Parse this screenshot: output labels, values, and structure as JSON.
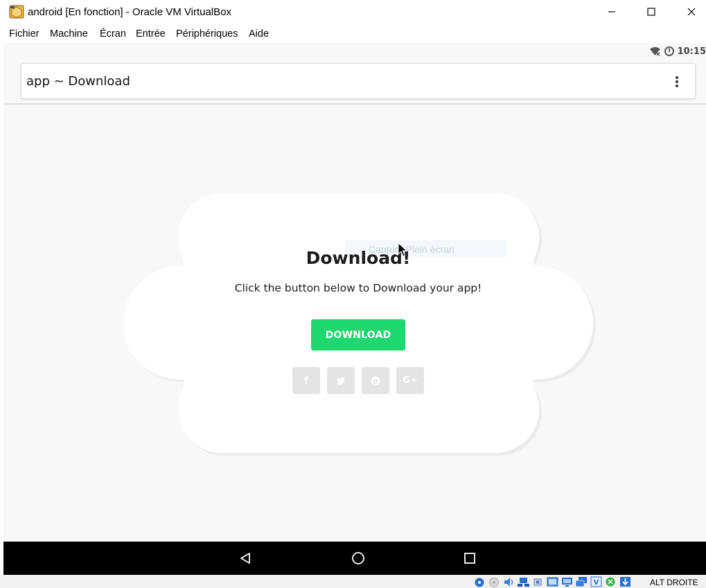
{
  "window": {
    "title": "android [En fonction] - Oracle VM VirtualBox",
    "app_icon": "virtualbox-icon",
    "controls": [
      "minimize-icon",
      "maximize-icon",
      "close-icon"
    ]
  },
  "menubar": {
    "items": [
      "Fichier",
      "Machine",
      "Écran",
      "Entrée",
      "Périphériques",
      "Aide"
    ]
  },
  "android": {
    "status_bar": {
      "time": "10:15",
      "icons": [
        "wifi-off-icon",
        "data-saver-icon"
      ]
    },
    "address_bar": {
      "title": "app ~ Download",
      "menu_icon": "overflow-menu-icon"
    },
    "page": {
      "tooltip": "Capture Plein écran",
      "heading": "Download!",
      "subtext": "Click the button below to Download your app!",
      "button_label": "DOWNLOAD",
      "button_color": "#1ed76e",
      "social": [
        {
          "name": "facebook",
          "glyph": "f"
        },
        {
          "name": "twitter",
          "glyph": "🐦"
        },
        {
          "name": "pinterest",
          "glyph": "℗"
        },
        {
          "name": "google-plus",
          "glyph": "G+"
        }
      ]
    },
    "nav_bar": [
      "back-icon",
      "home-icon",
      "recents-icon"
    ]
  },
  "vbox_status": {
    "host_key": "ALT DROITE",
    "icons": [
      "hard-disk-icon",
      "optical-drive-icon",
      "audio-icon",
      "network-icon",
      "usb-icon",
      "shared-folders-icon",
      "display-icon",
      "video-capture-icon",
      "virtualization-icon",
      "mouse-integration-icon",
      "keyboard-capture-icon"
    ]
  },
  "colors": {
    "accent": "#1ed76e",
    "guest_background": "#f7f8fa",
    "social_button": "#e4e4e4"
  }
}
